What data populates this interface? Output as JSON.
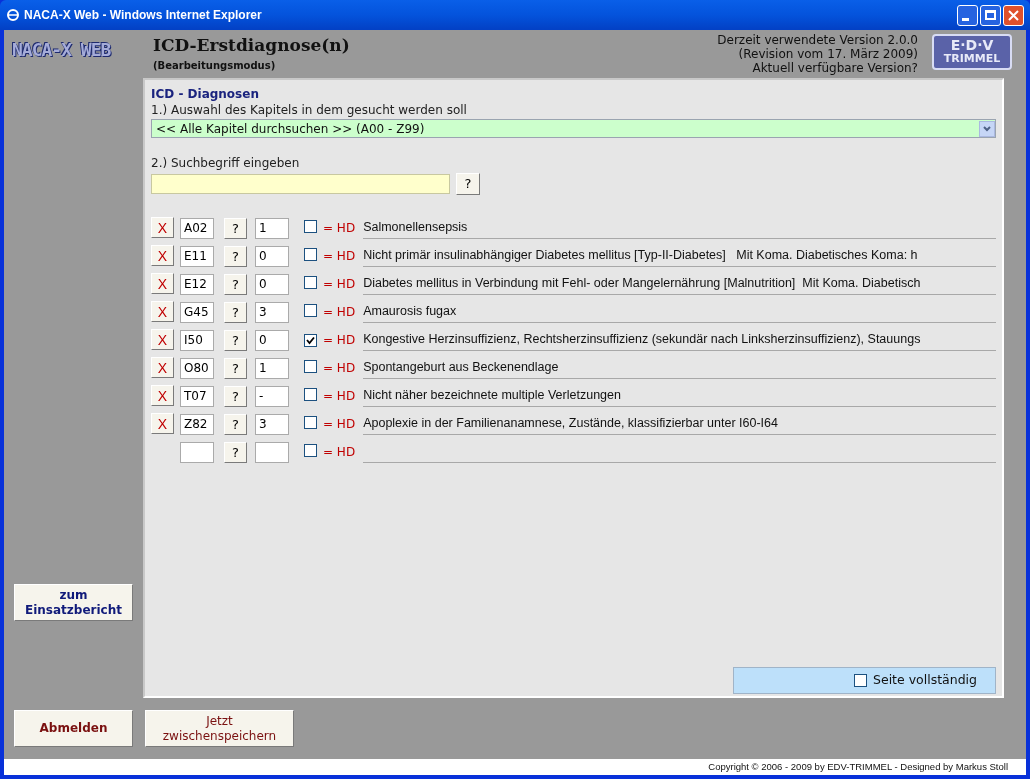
{
  "window": {
    "title": "NACA-X Web - Windows Internet Explorer"
  },
  "header": {
    "logo": "NACA-X WEB",
    "title": "ICD-Erstdiagnose(n)",
    "subtitle": "(Bearbeitungsmodus)",
    "version_lines": [
      "Derzeit verwendete Version 2.0.0",
      "(Revision vom 17. März 2009)"
    ],
    "version_link": "Aktuell verfügbare Version?",
    "brand_logo": {
      "top": "E·D·V",
      "bottom": "TRIMMEL"
    }
  },
  "section": {
    "heading": "ICD - Diagnosen",
    "step1_label": "1.) Auswahl des Kapitels in dem gesucht werden soll",
    "chapter_select": {
      "value": "<< Alle Kapitel durchsuchen >> (A00 - Z99)"
    },
    "step2_label": "2.) Suchbegriff eingeben",
    "help_button": "?"
  },
  "diagnoses": [
    {
      "remove": "X",
      "code": "A02",
      "help": "?",
      "value": "1",
      "hd_checked": false,
      "hd_label": "= HD",
      "description": "Salmonellensepsis"
    },
    {
      "remove": "X",
      "code": "E11",
      "help": "?",
      "value": "0",
      "hd_checked": false,
      "hd_label": "= HD",
      "description": "Nicht primär insulinabhängiger Diabetes mellitus [Typ-II-Diabetes]   Mit Koma. Diabetisches Koma: h"
    },
    {
      "remove": "X",
      "code": "E12",
      "help": "?",
      "value": "0",
      "hd_checked": false,
      "hd_label": "= HD",
      "description": "Diabetes mellitus in Verbindung mit Fehl- oder Mangelernährung [Malnutrition]  Mit Koma. Diabetisch"
    },
    {
      "remove": "X",
      "code": "G45",
      "help": "?",
      "value": "3",
      "hd_checked": false,
      "hd_label": "= HD",
      "description": "Amaurosis fugax"
    },
    {
      "remove": "X",
      "code": "I50",
      "help": "?",
      "value": "0",
      "hd_checked": true,
      "hd_label": "= HD",
      "description": "Kongestive Herzinsuffizienz, Rechtsherzinsuffizienz (sekundär nach Linksherzinsuffizienz), Stauungs"
    },
    {
      "remove": "X",
      "code": "O80",
      "help": "?",
      "value": "1",
      "hd_checked": false,
      "hd_label": "= HD",
      "description": "Spontangeburt aus Beckenendlage"
    },
    {
      "remove": "X",
      "code": "T07",
      "help": "?",
      "value": "-",
      "hd_checked": false,
      "hd_label": "= HD",
      "description": "Nicht näher bezeichnete multiple Verletzungen"
    },
    {
      "remove": "X",
      "code": "Z82",
      "help": "?",
      "value": "3",
      "hd_checked": false,
      "hd_label": "= HD",
      "description": "Apoplexie in der Familienanamnese, Zustände, klassifizierbar unter I60-I64"
    },
    {
      "help": "?",
      "hd_checked": false,
      "hd_label": "= HD"
    }
  ],
  "page_complete": {
    "label": "Seite vollständig",
    "checked": false
  },
  "sidebar_button": [
    "zum",
    "Einsatzbericht"
  ],
  "bottom_buttons": [
    {
      "kind": "bold",
      "lines": [
        "Abmelden"
      ]
    },
    {
      "kind": "plain",
      "lines": [
        "Jetzt",
        "zwischenspeichern"
      ]
    }
  ],
  "footer": "Copyright © 2006 - 2009 by EDV-TRIMMEL - Designed by Markus Stoll"
}
